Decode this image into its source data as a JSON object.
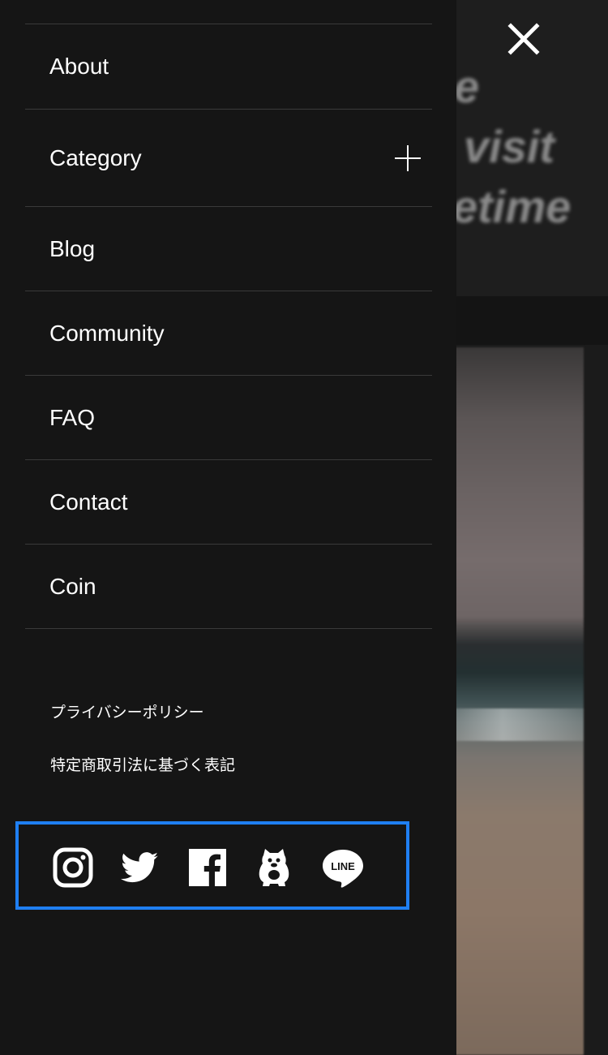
{
  "background": {
    "headline_lines": [
      "e",
      "visit",
      "etime"
    ]
  },
  "menu": {
    "items": [
      {
        "label": "About"
      },
      {
        "label": "Category",
        "expandable": true
      },
      {
        "label": "Blog"
      },
      {
        "label": "Community"
      },
      {
        "label": "FAQ"
      },
      {
        "label": "Contact"
      },
      {
        "label": "Coin"
      }
    ]
  },
  "footer_links": {
    "privacy": "プライバシーポリシー",
    "legal": "特定商取引法に基づく表記"
  },
  "social": {
    "icons": [
      "instagram-icon",
      "twitter-icon",
      "facebook-icon",
      "suzuri-icon",
      "line-icon"
    ],
    "line_text": "LINE",
    "highlight_color": "#1f7ff2"
  },
  "colors": {
    "drawer_bg": "#151515",
    "divider": "#3a3a3a",
    "text": "#ffffff"
  }
}
